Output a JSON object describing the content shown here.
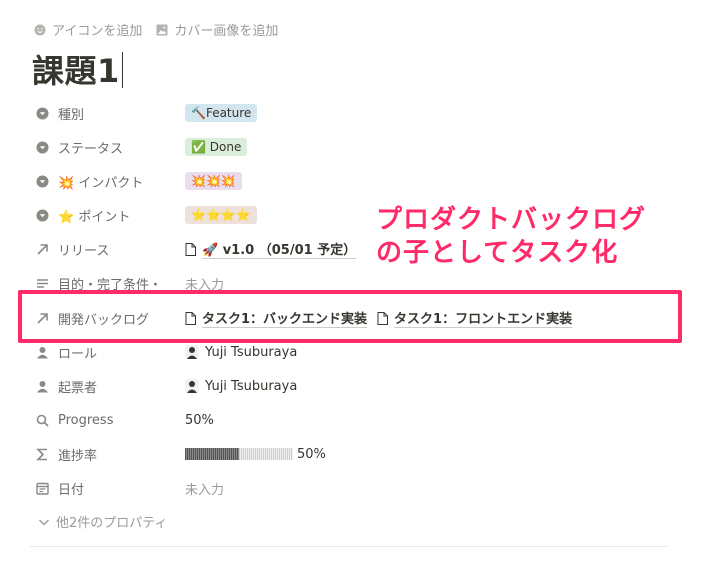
{
  "top_actions": {
    "add_icon": "アイコンを追加",
    "add_cover": "カバー画像を追加"
  },
  "title": "課題1",
  "properties": {
    "type": {
      "label": "種別",
      "value": "🔨Feature"
    },
    "status": {
      "label": "ステータス",
      "value": "✅ Done"
    },
    "impact": {
      "label": "💥 インパクト",
      "value": "💥💥💥"
    },
    "points": {
      "label": "⭐ ポイント",
      "value": "⭐⭐⭐⭐"
    },
    "release": {
      "label": "リリース",
      "value": "🚀 v1.0 （05/01 予定）"
    },
    "goal": {
      "label": "目的・完了条件・",
      "value": "未入力"
    },
    "backlog": {
      "label": "開発バックログ",
      "links": [
        "タスク1：バックエンド実装",
        "タスク1：フロントエンド実装"
      ]
    },
    "role": {
      "label": "ロール",
      "value": "Yuji Tsuburaya"
    },
    "creator": {
      "label": "起票者",
      "value": "Yuji Tsuburaya"
    },
    "progress": {
      "label": "Progress",
      "value": "50%"
    },
    "rate": {
      "label": "進捗率",
      "value": "50%",
      "fraction": 0.5
    },
    "date": {
      "label": "日付",
      "value": "未入力"
    }
  },
  "more": "他2件のプロパティ",
  "annotation": {
    "line1": "プロダクトバックログ",
    "line2": "の子としてタスク化"
  },
  "colors": {
    "annotation": "#ff2a68"
  }
}
